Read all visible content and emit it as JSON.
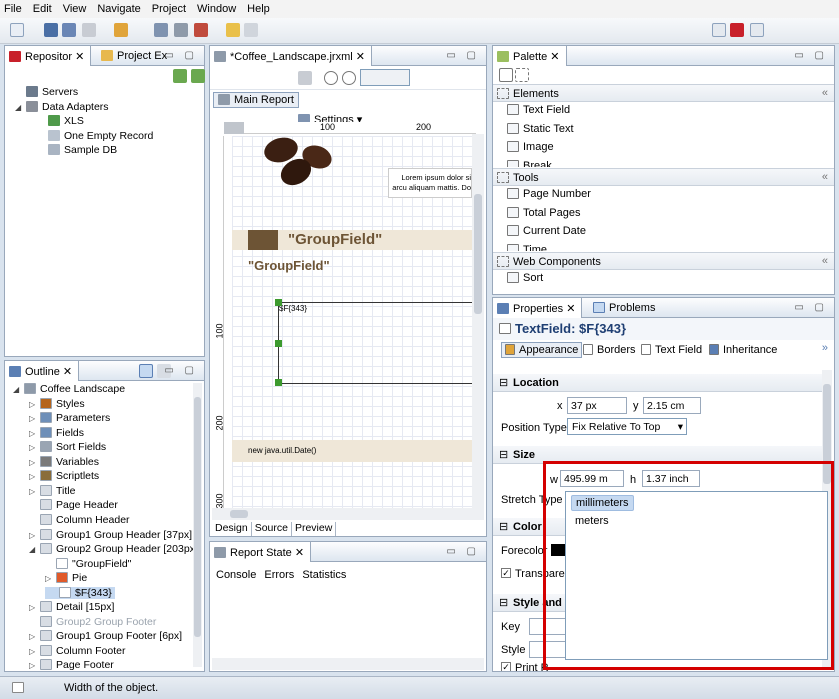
{
  "menu": [
    "File",
    "Edit",
    "View",
    "Navigate",
    "Project",
    "Window",
    "Help"
  ],
  "repository": {
    "tab_active": "Repositor",
    "tab_other": "Project Ex",
    "items": [
      {
        "label": "Servers",
        "level": 0
      },
      {
        "label": "Data Adapters",
        "level": 0
      },
      {
        "label": "XLS",
        "level": 1
      },
      {
        "label": "One Empty Record",
        "level": 1
      },
      {
        "label": "Sample DB",
        "level": 1
      }
    ]
  },
  "editor": {
    "tab": "*Coffee_Landscape.jrxml",
    "main_report": "Main Report",
    "settings": "Settings",
    "ruler_100": "100",
    "ruler_200": "200",
    "vruler_100": "100",
    "vruler_200": "200",
    "vruler_300": "300",
    "lorem1": "Lorem ipsum dolor si",
    "lorem2": "arcu aliquam mattis. Do",
    "groupfield1": "\"GroupField\"",
    "groupfield2": "\"GroupField\"",
    "field_label": "$F{343}",
    "date_expr": "new java.util.Date()",
    "bottom_tabs": [
      "Design",
      "Source",
      "Preview"
    ]
  },
  "outline": {
    "tab": "Outline",
    "items": [
      {
        "label": "Coffee Landscape",
        "level": 0
      },
      {
        "label": "Styles",
        "level": 1
      },
      {
        "label": "Parameters",
        "level": 1
      },
      {
        "label": "Fields",
        "level": 1
      },
      {
        "label": "Sort Fields",
        "level": 1
      },
      {
        "label": "Variables",
        "level": 1
      },
      {
        "label": "Scriptlets",
        "level": 1
      },
      {
        "label": "Title",
        "level": 1
      },
      {
        "label": "Page Header",
        "level": 1
      },
      {
        "label": "Column Header",
        "level": 1
      },
      {
        "label": "Group1 Group Header [37px]",
        "level": 1
      },
      {
        "label": "Group2 Group Header [203px]",
        "level": 1
      },
      {
        "label": "\"GroupField\"",
        "level": 2
      },
      {
        "label": "Pie",
        "level": 2
      },
      {
        "label": "$F{343}",
        "level": 2
      },
      {
        "label": "Detail [15px]",
        "level": 1
      },
      {
        "label": "Group2 Group Footer",
        "level": 1
      },
      {
        "label": "Group1 Group Footer [6px]",
        "level": 1
      },
      {
        "label": "Column Footer",
        "level": 1
      },
      {
        "label": "Page Footer",
        "level": 1
      }
    ]
  },
  "report_state": {
    "tab": "Report State",
    "tabs": [
      "Console",
      "Errors",
      "Statistics"
    ]
  },
  "palette": {
    "tab": "Palette",
    "elements_title": "Elements",
    "elements": [
      "Text Field",
      "Static Text",
      "Image",
      "Break"
    ],
    "tools_title": "Tools",
    "tools": [
      "Page Number",
      "Total Pages",
      "Current Date",
      "Time"
    ],
    "web_title": "Web Components",
    "web": [
      "Sort"
    ]
  },
  "properties": {
    "tab": "Properties",
    "tab_other": "Problems",
    "title": "TextField: $F{343}",
    "subtabs": [
      "Appearance",
      "Borders",
      "Text Field",
      "Inheritance"
    ],
    "location_title": "Location",
    "x_label": "x",
    "x_value": "37 px",
    "y_label": "y",
    "y_value": "2.15 cm",
    "position_type_label": "Position Type",
    "position_type_value": "Fix Relative To Top",
    "size_title": "Size",
    "w_label": "w",
    "w_value": "495.99 m",
    "h_label": "h",
    "h_value": "1.37 inch",
    "stretch_label": "Stretch Type",
    "color_title": "Color",
    "forecolor_label": "Forecolor",
    "transparent_label": "Transparent",
    "style_title": "Style and Pr",
    "key_label": "Key",
    "style_label": "Style",
    "print_label": "Print R",
    "unit_options": [
      "millimeters",
      "meters"
    ]
  },
  "status": "Width of the object.",
  "colors": {
    "accent": "#d40000",
    "selection": "#c5d9f1",
    "frame": "#99a8bb"
  }
}
